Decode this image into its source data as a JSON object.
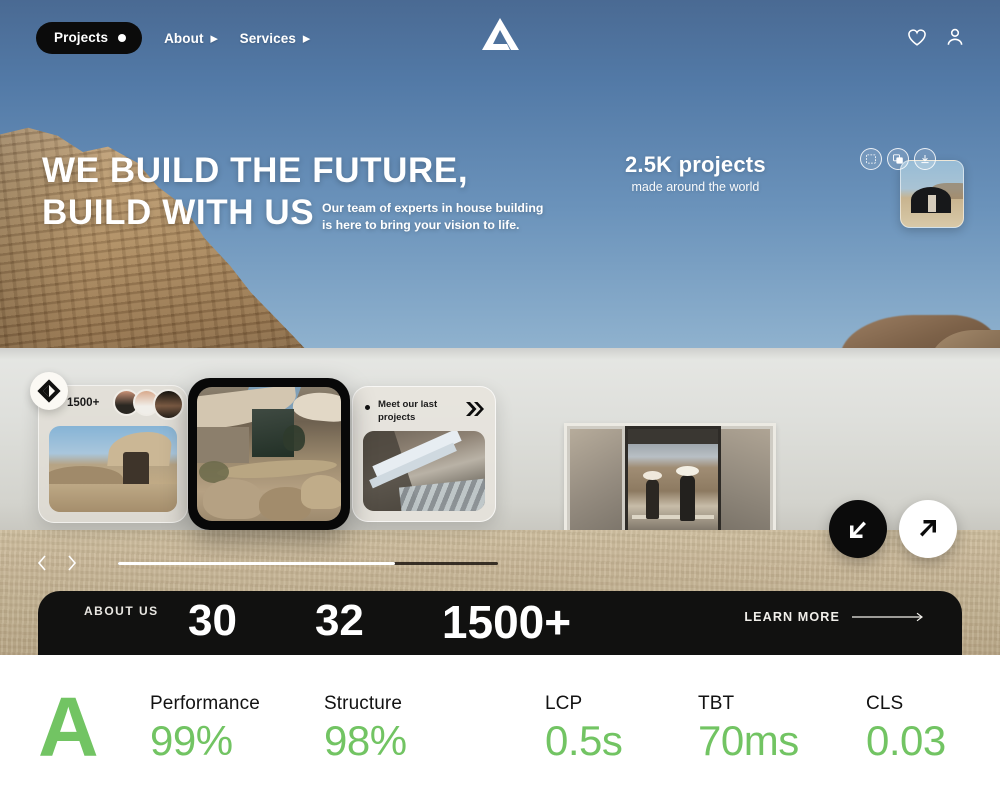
{
  "navbar": {
    "projects_label": "Projects",
    "links": [
      {
        "label": "About",
        "caret": "▶"
      },
      {
        "label": "Services",
        "caret": "▶"
      }
    ],
    "logo_name": "brand-logo",
    "icons": [
      {
        "name": "heart-icon"
      },
      {
        "name": "user-icon"
      }
    ]
  },
  "hero": {
    "headline_line1": "WE BUILD THE FUTURE,",
    "headline_line2": "BUILD WITH US",
    "subtext_line1": "Our team of experts in house building",
    "subtext_line2": "is here to bring your vision to life.",
    "stat_number": "2.5K projects",
    "stat_caption": "made around the world",
    "tools": [
      {
        "name": "crop-select-icon"
      },
      {
        "name": "copy-layers-icon"
      },
      {
        "name": "download-icon"
      }
    ],
    "thumbnail_name": "dome-house-thumbnail"
  },
  "carousel": {
    "card_a": {
      "count": "1500+",
      "avatars": [
        "avatar-1",
        "avatar-2",
        "avatar-3"
      ],
      "image_name": "desert-house-photo"
    },
    "card_b": {
      "image_name": "modern-desert-villa-photo"
    },
    "card_c": {
      "title_line1": "Meet our last",
      "title_line2": "projects",
      "image_name": "concrete-architecture-photo",
      "logo_name": "chevron-brand-icon"
    },
    "badge_name": "diamond-brand-badge",
    "prev_label": "‹",
    "next_label": "›",
    "progress_percent": 73
  },
  "actions": {
    "down_left_label": "scroll-down-button",
    "up_right_label": "open-external-button"
  },
  "about": {
    "label": "ABOUT US",
    "numbers": [
      "30",
      "32",
      "1500+"
    ],
    "cta": "LEARN MORE"
  },
  "metrics": {
    "grade": "A",
    "accent_color": "#72c463",
    "items": [
      {
        "label": "Performance",
        "value": "99%"
      },
      {
        "label": "Structure",
        "value": "98%"
      },
      {
        "label": "LCP",
        "value": "0.5s"
      },
      {
        "label": "TBT",
        "value": "70ms"
      },
      {
        "label": "CLS",
        "value": "0.03"
      }
    ]
  }
}
